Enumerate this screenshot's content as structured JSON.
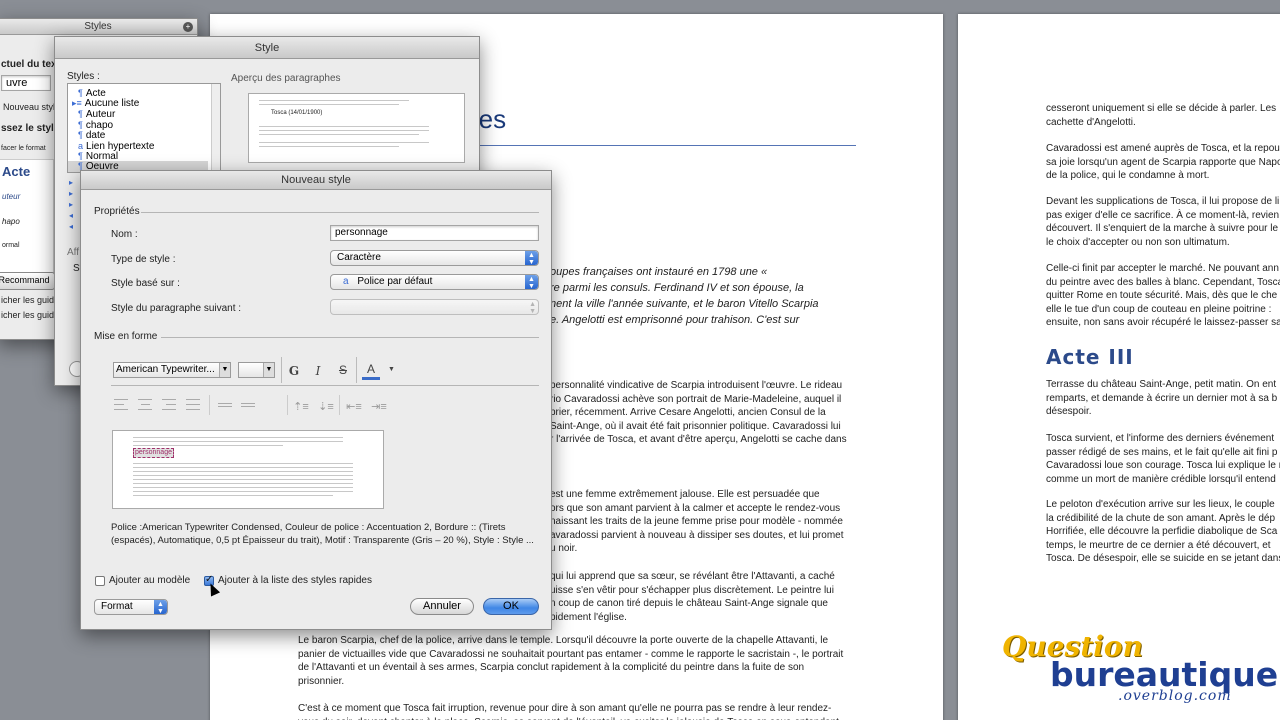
{
  "doc_left": {
    "title_fragment": "res",
    "italic_lines": [
      "oupes françaises ont instauré en 1798 une «",
      "re parmi les consuls. Ferdinand IV et son épouse, la",
      "nent la ville l'année suivante, et le baron Vitello Scarpia",
      "e. Angelotti est emprisonné pour trahison. C'est sur"
    ],
    "para1": "personnalité vindicative de Scarpia introduisent l'œuvre. Le rideau\nrio Cavaradossi achève son portrait de Marie-Madeleine, auquel il\nprier, récemment. Arrive Cesare Angelotti, ancien Consul de la\nSaint-Ange, où il avait été fait prisonnier politique. Cavaradossi lui\nr l'arrivée de Tosca, et avant d'être aperçu, Angelotti se cache dans",
    "para2": "est une femme extrêmement jalouse. Elle est persuadée que\nors que son amant parvient à la calmer et accepte le rendez-vous\nnaissant les traits de la jeune femme prise pour modèle - nommée\navaradossi parvient à nouveau à dissiper ses doutes, et lui promet\nu noir.",
    "para3": "qui lui apprend que sa sœur, se révélant être l'Attavanti, a caché\nuisse s'en vêtir pour s'échapper plus discrètement. Le peintre lui\nn coup de canon tiré depuis le château Saint-Ange signale que\npidement l'église.",
    "para4": "Le baron Scarpia, chef de la police, arrive dans le temple. Lorsqu'il découvre la porte ouverte de la chapelle Attavanti, le\npanier de victuailles vide que Cavaradossi ne souhaitait pourtant pas entamer - comme le rapporte le sacristain -, le portrait\nde l'Attavanti et un éventail à ses armes, Scarpia conclut rapidement à la complicité du peintre dans la fuite de son\nprisonnier.",
    "para5": "C'est à ce moment que Tosca fait irruption, revenue pour dire à son amant qu'elle ne pourra pas se rendre à leur rendez-\nvous du soir, devant chanter à la place. Scarpia, se servant de l'éventail, va exciter la jalousie de Tosca en sous-entendant"
  },
  "doc_right": {
    "p1": "cesseront uniquement si elle se décide à parler. Les\ncachette d'Angelotti.",
    "p2": "Cavaradossi est amené auprès de Tosca, et la repous\nsa joie lorsqu'un agent de Scarpia rapporte que Napo\nde la police, qui le condamne à mort.",
    "p3": "Devant les supplications de Tosca, il lui propose de li\npas exiger d'elle ce sacrifice. À ce moment-là, revien\ndécouvert. Il s'enquiert de la marche à suivre pour le\nle choix d'accepter ou non son ultimatum.",
    "p4": "Celle-ci finit par accepter le marché. Ne pouvant ann\ndu peintre avec des balles à blanc. Cependant, Tosca\nquitter Rome en toute sécurité. Mais, dès que le che\nelle le tue d'un coup de couteau en pleine poitrine :\nensuite, non sans avoir récupéré le laissez-passer sa",
    "heading": "Acte III",
    "p5": "Terrasse du château Saint-Ange, petit matin. On ent\nremparts, et demande à écrire un dernier mot à sa b\ndésespoir.",
    "p6": "Tosca survient, et l'informe des derniers événement\npasser rédigé de ses mains, et le fait qu'elle ait fini p\nCavaradossi loue son courage. Tosca lui explique le r\ncomme un mort de manière crédible lorsqu'il entend",
    "p7": "Le peloton d'exécution arrive sur les lieux, le couple\nla crédibilité de la chute de son amant. Après le dép\nHorrifiée, elle découvre la perfidie diabolique de Sca\ntemps, le meurtre de ce dernier a été découvert, et\nTosca. De désespoir, elle se suicide en se jetant dans"
  },
  "styles_palette": {
    "title": "Styles",
    "current_label": "ctuel du texte",
    "current_value": "uvre",
    "new_style": "Nouveau style",
    "choose": "ssez le style",
    "clear_format": "facer le format",
    "samples": [
      "Acte",
      "uteur",
      "hapo",
      "ormal"
    ],
    "recommend": "Recommand",
    "show1": "icher les guid",
    "show2": "icher les guid"
  },
  "style_dialog": {
    "title": "Style",
    "styles_label": "Styles :",
    "preview_label": "Aperçu des paragraphes",
    "items": [
      "Acte",
      "Aucune liste",
      "Auteur",
      "chapo",
      "date",
      "Lien hypertexte",
      "Normal",
      "Oeuvre"
    ],
    "preview_heading": "Tosca (14/01/1900)",
    "affix_label": "Aff",
    "st_label": "St"
  },
  "new_style_dialog": {
    "title": "Nouveau style",
    "props_label": "Propriétés",
    "name_label": "Nom :",
    "name_value": "personnage",
    "type_label": "Type de style :",
    "type_value": "Caractère",
    "based_label": "Style basé sur :",
    "based_value": "Police par défaut",
    "next_label": "Style du paragraphe suivant :",
    "format_label": "Mise en forme",
    "font_value": "American Typewriter...",
    "bold": "G",
    "italic": "I",
    "strike": "S",
    "color": "A",
    "preview_word": "personnage",
    "description": "Police :American Typewriter Condensed, Couleur de police : Accentuation 2, Bordure :: (Tirets (espacés), Automatique,  0,5 pt Épaisseur du trait), Motif : Transparente (Gris – 20 %), Style : Style ...",
    "add_template": "Ajouter au modèle",
    "add_quick": "Ajouter à la liste des styles rapides",
    "format_button": "Format",
    "cancel": "Annuler",
    "ok": "OK"
  },
  "watermark": {
    "line1": "Question",
    "line2": "bureautique",
    "line3": ".overblog.com"
  }
}
